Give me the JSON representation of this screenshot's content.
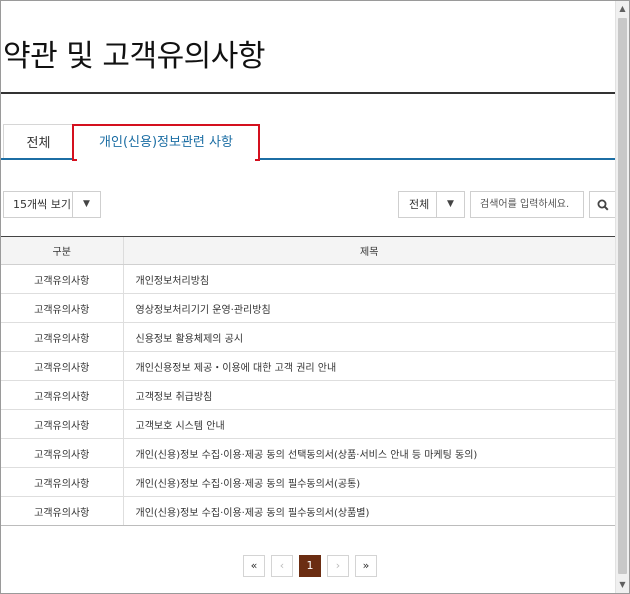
{
  "page": {
    "title": "약관 및 고객유의사항"
  },
  "tabs": [
    {
      "label": "전체"
    },
    {
      "label": "개인(신용)정보관련 사항"
    }
  ],
  "controls": {
    "page_size": "15개씩 보기",
    "scope": "전체",
    "search_placeholder": "검색어를 입력하세요.",
    "arrow_icon": "▼"
  },
  "table": {
    "headers": [
      "구분",
      "제목"
    ],
    "rows": [
      {
        "category": "고객유의사항",
        "title": "개인정보처리방침"
      },
      {
        "category": "고객유의사항",
        "title": "영상정보처리기기 운영·관리방침"
      },
      {
        "category": "고객유의사항",
        "title": "신용정보 활용체제의 공시"
      },
      {
        "category": "고객유의사항",
        "title": "개인신용정보 제공・이용에 대한 고객 권리 안내"
      },
      {
        "category": "고객유의사항",
        "title": "고객정보 취급방침"
      },
      {
        "category": "고객유의사항",
        "title": "고객보호 시스템 안내"
      },
      {
        "category": "고객유의사항",
        "title": "개인(신용)정보 수집·이용·제공 동의 선택동의서(상품·서비스 안내 등 마케팅 동의)"
      },
      {
        "category": "고객유의사항",
        "title": "개인(신용)정보 수집·이용·제공 동의 필수동의서(공통)"
      },
      {
        "category": "고객유의사항",
        "title": "개인(신용)정보 수집·이용·제공 동의 필수동의서(상품별)"
      }
    ]
  },
  "pagination": {
    "first": "«",
    "prev": "‹",
    "current": "1",
    "next": "›",
    "last": "»"
  },
  "colors": {
    "tab_active_text": "#1c6ea4",
    "tab_highlight_border": "#d4101e",
    "page_current_bg": "#6b2d12"
  }
}
